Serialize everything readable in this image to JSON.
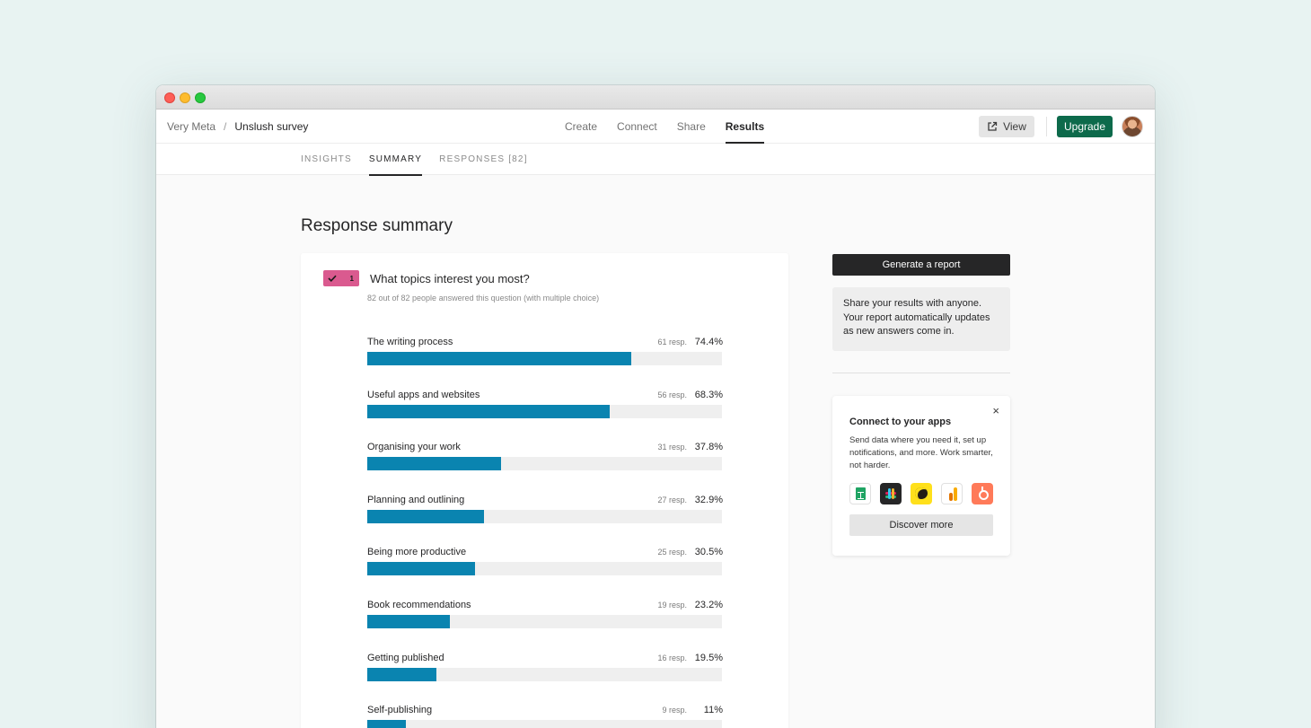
{
  "breadcrumb": {
    "workspace": "Very Meta",
    "separator": "/",
    "form": "Unslush survey"
  },
  "nav": {
    "create": "Create",
    "connect": "Connect",
    "share": "Share",
    "results": "Results"
  },
  "header": {
    "view_label": "View",
    "upgrade_label": "Upgrade"
  },
  "subnav": {
    "insights": "INSIGHTS",
    "summary": "SUMMARY",
    "responses": "RESPONSES [82]"
  },
  "page_title": "Response summary",
  "question": {
    "number": "1",
    "title": "What topics interest you most?",
    "subtitle": "82 out of 82 people answered this question (with multiple choice)",
    "options": [
      {
        "label": "The writing process",
        "resp": "61 resp.",
        "pct": "74.4%",
        "value": 74.4
      },
      {
        "label": "Useful apps and websites",
        "resp": "56 resp.",
        "pct": "68.3%",
        "value": 68.3
      },
      {
        "label": "Organising your work",
        "resp": "31 resp.",
        "pct": "37.8%",
        "value": 37.8
      },
      {
        "label": "Planning and outlining",
        "resp": "27 resp.",
        "pct": "32.9%",
        "value": 32.9
      },
      {
        "label": "Being more productive",
        "resp": "25 resp.",
        "pct": "30.5%",
        "value": 30.5
      },
      {
        "label": "Book recommendations",
        "resp": "19 resp.",
        "pct": "23.2%",
        "value": 23.2
      },
      {
        "label": "Getting published",
        "resp": "16 resp.",
        "pct": "19.5%",
        "value": 19.5
      },
      {
        "label": "Self-publishing",
        "resp": "9 resp.",
        "pct": "11%",
        "value": 11
      }
    ]
  },
  "sidebar": {
    "generate_label": "Generate a report",
    "share_text": "Share your results with anyone. Your report automatically updates as new answers come in.",
    "apps": {
      "close": "×",
      "title": "Connect to your apps",
      "text": "Send data where you need it, set up notifications, and more. Work smarter, not harder.",
      "icons": [
        "google-sheets-icon",
        "slack-icon",
        "mailchimp-icon",
        "google-analytics-icon",
        "hubspot-icon"
      ],
      "discover_label": "Discover more"
    }
  },
  "colors": {
    "bar": "#0a84b0",
    "upgrade": "#0d6a4b",
    "badge": "#da5a8f"
  }
}
